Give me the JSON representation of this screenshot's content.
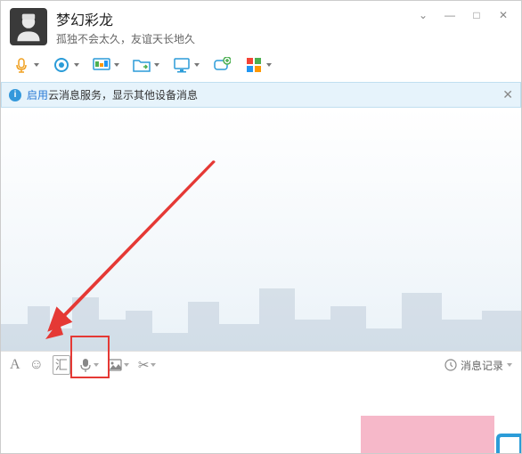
{
  "contact": {
    "name": "梦幻彩龙",
    "signature": "孤独不会太久，友谊天长地久"
  },
  "window_controls": {
    "dropdown": "⌄",
    "minimize": "—",
    "maximize": "□",
    "close": "✕"
  },
  "notification": {
    "link": "启用",
    "text": "云消息服务，显示其他设备消息",
    "close": "✕"
  },
  "input_toolbar": {
    "font": "A",
    "emoji": "☺",
    "vip": "汇",
    "scissors": "✂"
  },
  "msg_history": {
    "label": "消息记录"
  }
}
